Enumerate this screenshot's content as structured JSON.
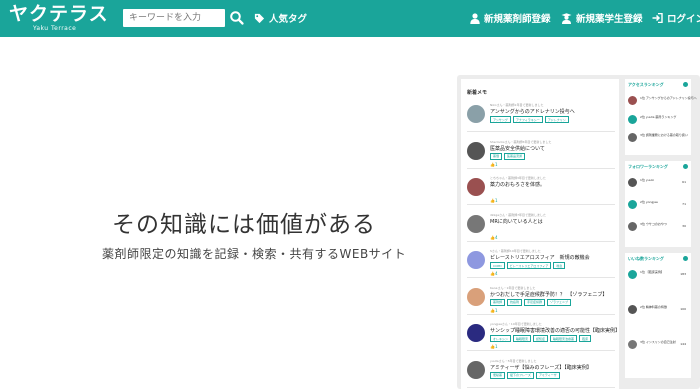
{
  "header": {
    "logo_text": "ヤクテラス",
    "logo_sub": "Yaku Terrace",
    "search_placeholder": "キーワードを入力",
    "popular_tags": "人気タグ",
    "register_pharmacist": "新規薬剤師登録",
    "register_student": "新規薬学生登録",
    "login": "ログイン"
  },
  "hero": {
    "title": "その知識には価値がある",
    "subtitle": "薬剤師限定の知識を記録・検索・共有するWEBサイト"
  },
  "mock": {
    "column_title": "新着メモ",
    "memos": [
      {
        "meta": "Nikoさん・薬剤師1年目で更新しました",
        "title": "アンサングからのアドレナリン投与へ",
        "tags": [
          "アンサング",
          "アナフィラキシー",
          "アドレナリン"
        ],
        "like": "",
        "avatar": "#8aa0a8"
      },
      {
        "meta": "Sherlocksさん・薬剤師5年目で更新しました",
        "title": "医薬品安全供給について",
        "tags": [
          "薬価",
          "医薬品流通"
        ],
        "like": "1",
        "avatar": "#555"
      },
      {
        "meta": "とちちゃん・薬剤師3年目で更新しました",
        "title": "薬力のおもろさを体感。",
        "tags": [],
        "like": "1",
        "avatar": "#9a5050"
      },
      {
        "meta": "dkkgaさん・薬剤師7年目で更新しました",
        "title": "MRに向いている人とは",
        "tags": [],
        "like": "4",
        "avatar": "#777"
      },
      {
        "meta": "Sさん・薬剤師10年目で更新しました",
        "title": "ピレーストリエアロスフィア　新規の敵機会",
        "tags": [
          "COPD",
          "ビレーストリエアロスフィア",
          "喘息"
        ],
        "like": "4",
        "avatar": "#8e98e0"
      },
      {
        "meta": "Kanaさん・1年目で更新しました",
        "title": "かつおだしで手足症候群予防！？　【ゾラフェニブ】",
        "tags": [
          "薬剤師",
          "抗癌剤",
          "手足症候群",
          "ゾラフェニブ"
        ],
        "like": "1",
        "avatar": "#d9a07a"
      },
      {
        "meta": "yongjaeさん・10年目で更新しました",
        "title": "サンシップ睡眠障害環境改善の適否の可能性【臨床実例】",
        "tags": [
          "オレキシン",
          "睡眠障害",
          "認知症",
          "睡眠障害治療薬",
          "臨床"
        ],
        "like": "1",
        "avatar": "#2a2a80"
      },
      {
        "meta": "yuutaさん・5年目で更新しました",
        "title": "アミティーザ【悩みのフレーズ】【臨床実例】",
        "tags": [
          "便秘薬",
          "緩下のフレーズ",
          "アミティーザ"
        ],
        "like": "",
        "avatar": "#666"
      }
    ],
    "panels": [
      {
        "title": "アクセスランキング",
        "rows": [
          {
            "text": "1位 アンサングからのアドレナリン投与へ",
            "num": "",
            "avatar": "#9a5050"
          },
          {
            "text": "2位 yuuta 薬局ランキング",
            "num": "",
            "avatar": "#1aa59a"
          },
          {
            "text": "3位 調剤業務における薬の取り扱い",
            "num": "",
            "avatar": "#666"
          }
        ]
      },
      {
        "title": "フォロワーランキング",
        "rows": [
          {
            "text": "1位 yuuki",
            "num": "61",
            "avatar": "#555"
          },
          {
            "text": "2位 yongjae",
            "num": "71",
            "avatar": "#1aa59a"
          },
          {
            "text": "3位 ウサコのおやつ",
            "num": "30",
            "avatar": "#666"
          }
        ]
      },
      {
        "title": "いいね数ランキング",
        "rows": [
          {
            "text": "1位 【臨床実例】",
            "num": "183",
            "avatar": "#1aa59a"
          },
          {
            "text": "2位 精神科薬の特徴",
            "num": "100",
            "avatar": "#555"
          },
          {
            "text": "3位 インスリンの自己注射",
            "num": "144",
            "avatar": "#777"
          }
        ]
      }
    ]
  },
  "colors": {
    "brand": "#1aa59a"
  }
}
